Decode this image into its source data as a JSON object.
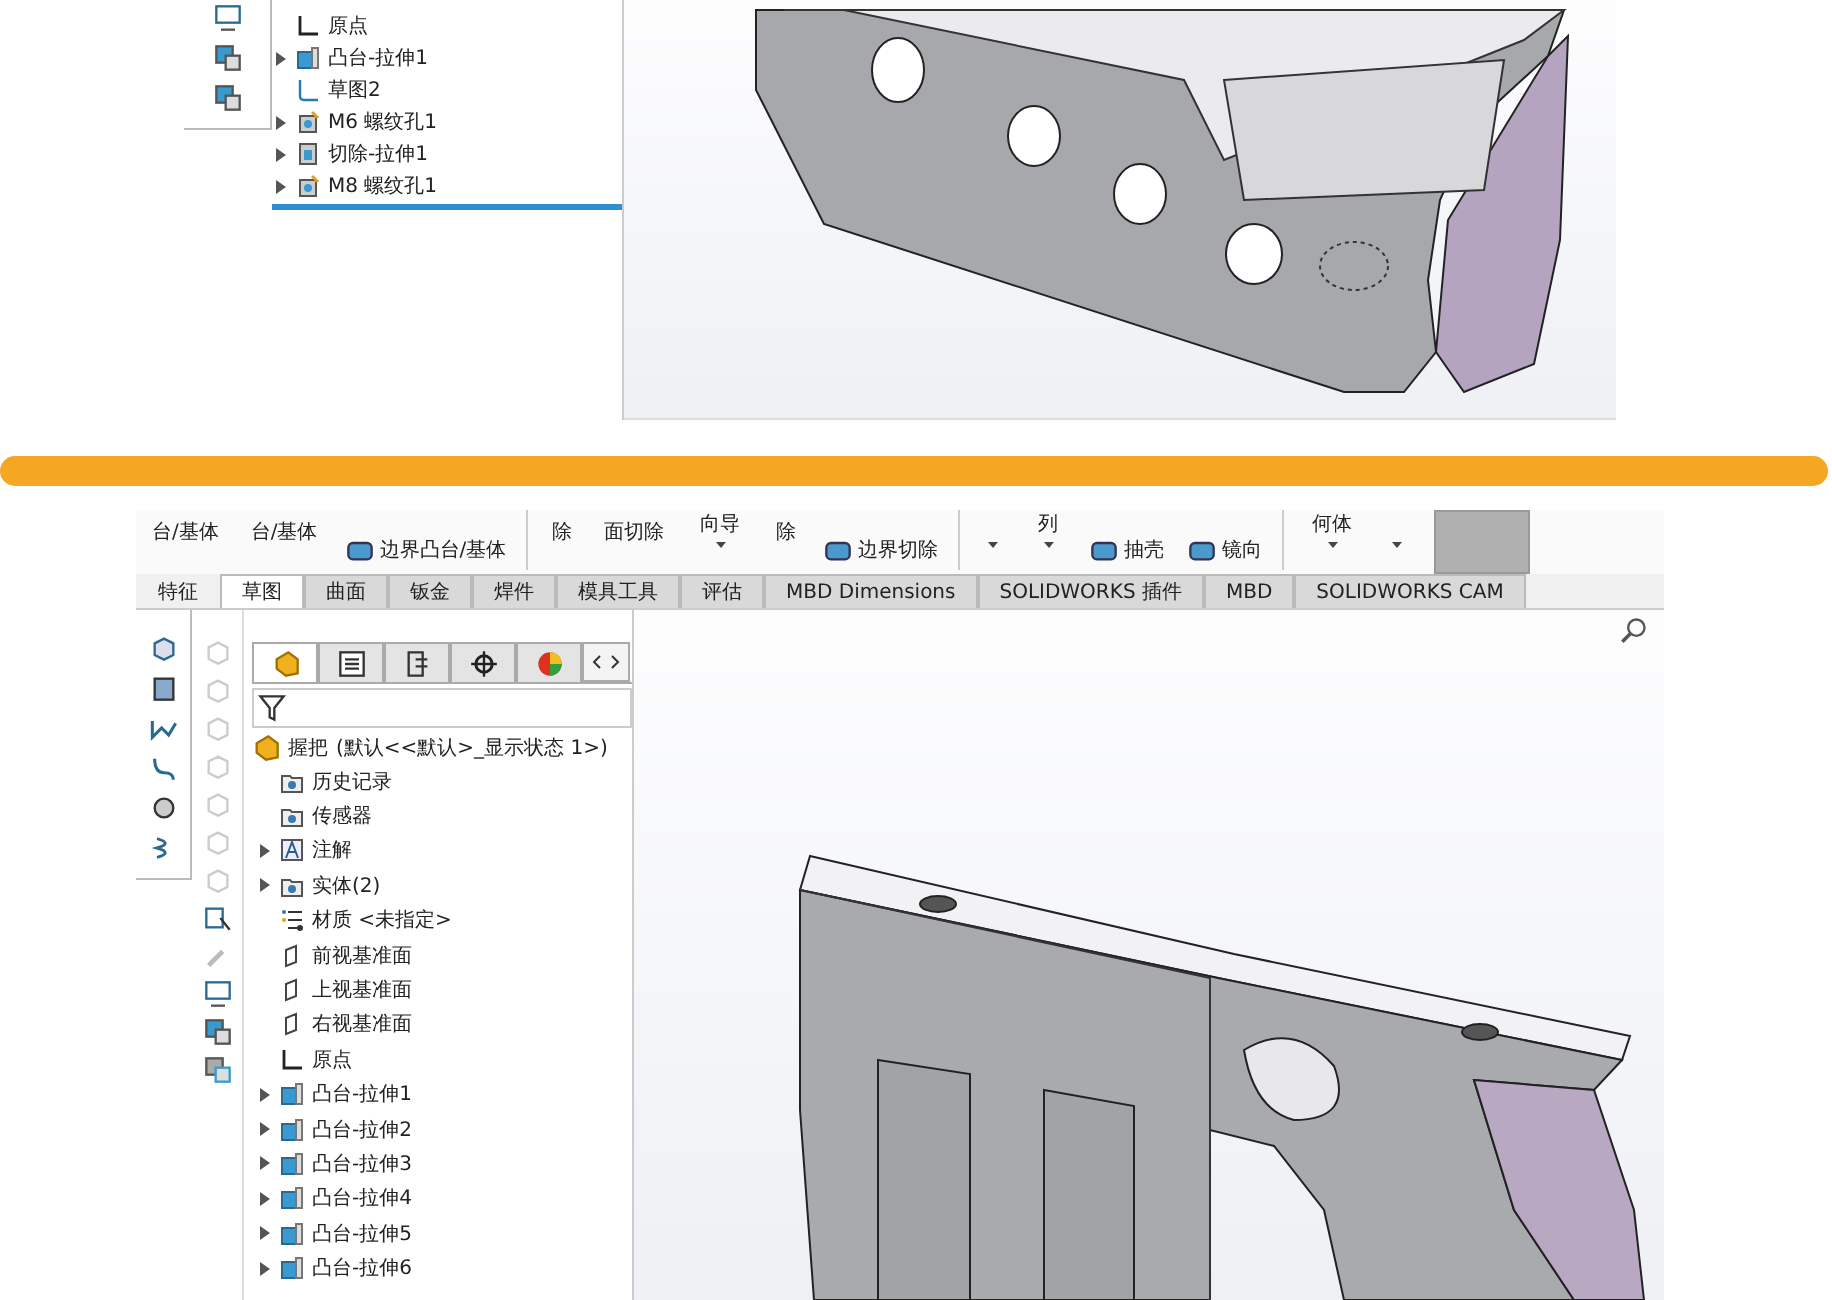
{
  "top_view": {
    "side_icons": [
      {
        "kind": "sketch"
      },
      {
        "kind": "part"
      },
      {
        "kind": "part"
      }
    ],
    "tree": [
      {
        "label": "原点",
        "kind": "origin",
        "has_children": false
      },
      {
        "label": "凸台-拉伸1",
        "kind": "extrude",
        "has_children": true
      },
      {
        "label": "草图2",
        "kind": "sketch",
        "has_children": false
      },
      {
        "label": "M6 螺纹孔1",
        "kind": "hole",
        "has_children": true
      },
      {
        "label": "切除-拉伸1",
        "kind": "cut",
        "has_children": true
      },
      {
        "label": "M8 螺纹孔1",
        "kind": "hole",
        "has_children": true
      }
    ]
  },
  "bottom_view": {
    "ribbon": [
      {
        "kind": "large",
        "label": "台/基体"
      },
      {
        "kind": "large",
        "label": "台/基体"
      },
      {
        "kind": "stack",
        "label": "边界凸台/基体"
      },
      {
        "kind": "separator"
      },
      {
        "kind": "large",
        "label": "除"
      },
      {
        "kind": "large",
        "label": "面切除"
      },
      {
        "kind": "dropdown",
        "label": "向导"
      },
      {
        "kind": "large",
        "label": "除"
      },
      {
        "kind": "stack",
        "label": "边界切除"
      },
      {
        "kind": "separator"
      },
      {
        "kind": "dropdown"
      },
      {
        "kind": "dropdown",
        "label": "列"
      },
      {
        "kind": "stack",
        "label": "抽壳"
      },
      {
        "kind": "stack",
        "label": "镜向"
      },
      {
        "kind": "separator"
      },
      {
        "kind": "dropdown",
        "label": "何体"
      },
      {
        "kind": "dropdown"
      },
      {
        "kind": "panel"
      }
    ],
    "tabs": [
      {
        "label": "特征",
        "selected": false
      },
      {
        "label": "草图",
        "selected": true
      },
      {
        "label": "曲面",
        "selected": false
      },
      {
        "label": "钣金",
        "selected": false
      },
      {
        "label": "焊件",
        "selected": false
      },
      {
        "label": "模具工具",
        "selected": false
      },
      {
        "label": "评估",
        "selected": false
      },
      {
        "label": "MBD Dimensions",
        "selected": false
      },
      {
        "label": "SOLIDWORKS 插件",
        "selected": false
      },
      {
        "label": "MBD",
        "selected": false
      },
      {
        "label": "SOLIDWORKS CAM",
        "selected": false
      }
    ],
    "panel_tabs": [
      {
        "kind": "feature",
        "selected": true
      },
      {
        "kind": "property",
        "selected": false
      },
      {
        "kind": "config",
        "selected": false
      },
      {
        "kind": "target",
        "selected": false
      },
      {
        "kind": "appearance",
        "selected": false
      }
    ],
    "root": {
      "label": "握把",
      "detail": "(默认<<默认>_显示状态 1>)"
    },
    "tree": [
      {
        "label": "历史记录",
        "kind": "folder",
        "has_children": false
      },
      {
        "label": "传感器",
        "kind": "folder",
        "has_children": false
      },
      {
        "label": "注解",
        "kind": "annotation",
        "has_children": true
      },
      {
        "label": "实体(2)",
        "kind": "folder",
        "has_children": true
      },
      {
        "label": "材质 <未指定>",
        "kind": "material",
        "has_children": false
      },
      {
        "label": "前视基准面",
        "kind": "plane",
        "has_children": false
      },
      {
        "label": "上视基准面",
        "kind": "plane",
        "has_children": false
      },
      {
        "label": "右视基准面",
        "kind": "plane",
        "has_children": false
      },
      {
        "label": "原点",
        "kind": "origin",
        "has_children": false
      },
      {
        "label": "凸台-拉伸1",
        "kind": "extrude",
        "has_children": true
      },
      {
        "label": "凸台-拉伸2",
        "kind": "extrude",
        "has_children": true
      },
      {
        "label": "凸台-拉伸3",
        "kind": "extrude",
        "has_children": true
      },
      {
        "label": "凸台-拉伸4",
        "kind": "extrude",
        "has_children": true
      },
      {
        "label": "凸台-拉伸5",
        "kind": "extrude",
        "has_children": true
      },
      {
        "label": "凸台-拉伸6",
        "kind": "extrude",
        "has_children": true
      }
    ]
  }
}
